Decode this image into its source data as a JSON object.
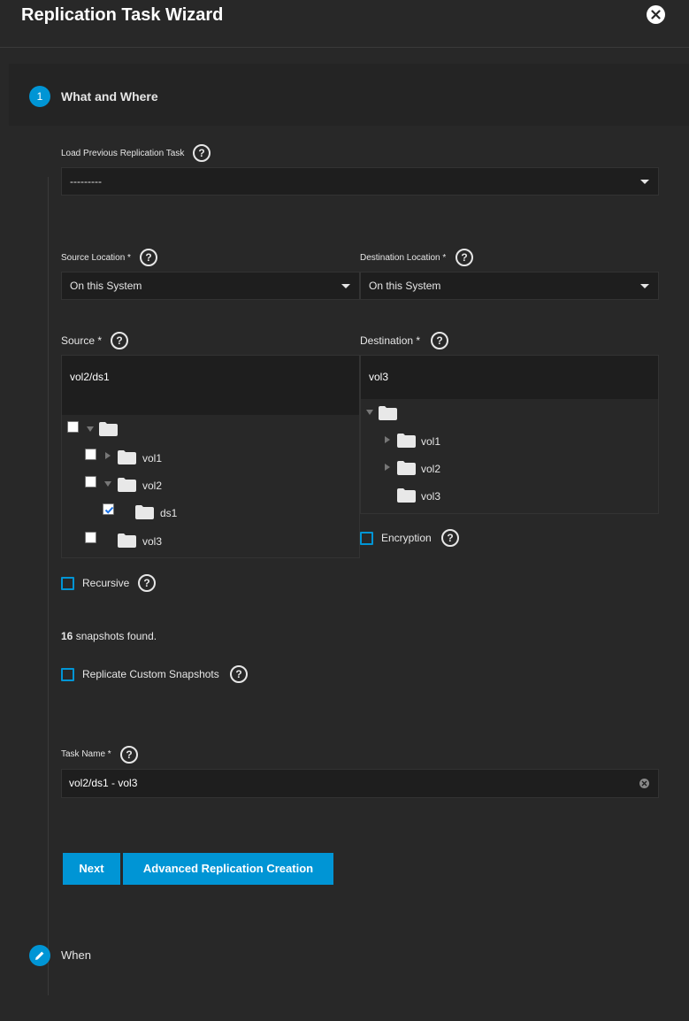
{
  "header": {
    "title": "Replication Task Wizard"
  },
  "step1": {
    "number": "1",
    "title": "What and Where"
  },
  "load_previous": {
    "label": "Load Previous Replication Task",
    "value": "---------"
  },
  "source_location": {
    "label": "Source Location *",
    "value": "On this System"
  },
  "destination_location": {
    "label": "Destination Location *",
    "value": "On this System"
  },
  "source": {
    "label": "Source *",
    "path": "vol2/ds1",
    "tree": [
      {
        "label": "",
        "checked": false,
        "expanded": true
      },
      {
        "label": "vol1",
        "checked": false,
        "expanded": false
      },
      {
        "label": "vol2",
        "checked": false,
        "expanded": true
      },
      {
        "label": "ds1",
        "checked": true
      },
      {
        "label": "vol3",
        "checked": false
      }
    ]
  },
  "destination": {
    "label": "Destination *",
    "path": "vol3",
    "tree": [
      {
        "label": "",
        "expanded": true
      },
      {
        "label": "vol1",
        "expanded": false
      },
      {
        "label": "vol2",
        "expanded": false
      },
      {
        "label": "vol3"
      }
    ]
  },
  "encryption": {
    "label": "Encryption",
    "checked": false
  },
  "recursive": {
    "label": "Recursive",
    "checked": false
  },
  "snapshots": {
    "count": "16",
    "text": " snapshots found."
  },
  "custom_snapshots": {
    "label": "Replicate Custom Snapshots",
    "checked": false
  },
  "task_name": {
    "label": "Task Name *",
    "value": "vol2/ds1 - vol3"
  },
  "buttons": {
    "next": "Next",
    "advanced": "Advanced Replication Creation"
  },
  "step2": {
    "title": "When"
  },
  "colors": {
    "accent": "#0095d5",
    "background": "#282828",
    "input_bg": "#1e1e1e"
  },
  "icons": {
    "close": "close-icon",
    "help": "help-icon",
    "folder": "folder-icon",
    "edit": "pencil-icon"
  }
}
